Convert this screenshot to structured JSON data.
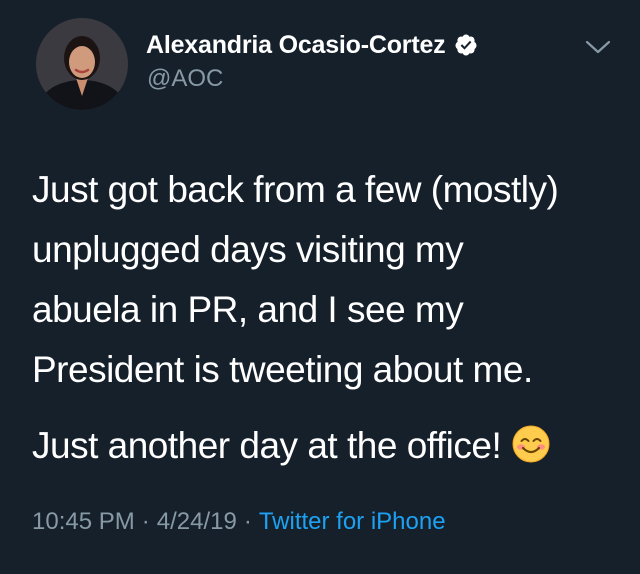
{
  "tweet": {
    "author": {
      "display_name": "Alexandria Ocasio-Cortez",
      "handle": "@AOC",
      "verified": true,
      "avatar_icon": "profile-photo"
    },
    "text": {
      "paragraph1_lines": [
        "Just got back from a few (mostly)",
        "unplugged days visiting my",
        "abuela in PR, and I see my",
        "President is tweeting about me."
      ],
      "paragraph2": "Just another day at the office!",
      "emoji": "smiling-face-with-smiling-eyes"
    },
    "meta": {
      "time": "10:45 PM",
      "separator1": "·",
      "date": "4/24/19",
      "separator2": "·",
      "source": "Twitter for iPhone"
    },
    "icons": {
      "verified": "verified-badge-icon",
      "menu": "chevron-down-icon"
    },
    "colors": {
      "background": "#15202b",
      "text": "#ffffff",
      "secondary": "#8899a6",
      "link": "#1da1f2"
    }
  }
}
